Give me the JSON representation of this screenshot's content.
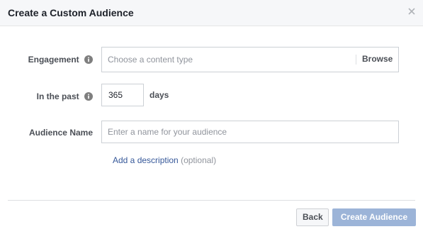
{
  "dialog": {
    "title": "Create a Custom Audience"
  },
  "form": {
    "engagement": {
      "label": "Engagement",
      "placeholder": "Choose a content type",
      "browse_label": "Browse"
    },
    "in_the_past": {
      "label": "In the past",
      "value": "365",
      "unit": "days"
    },
    "audience_name": {
      "label": "Audience Name",
      "placeholder": "Enter a name for your audience"
    },
    "description": {
      "link_label": "Add a description",
      "optional_label": "(optional)"
    }
  },
  "footer": {
    "back_label": "Back",
    "create_label": "Create Audience"
  },
  "colors": {
    "header_bg": "#f6f7f9",
    "link": "#365899",
    "primary_disabled": "#9cb4d8"
  },
  "icons": {
    "close": "close-icon",
    "info": "info-icon"
  }
}
